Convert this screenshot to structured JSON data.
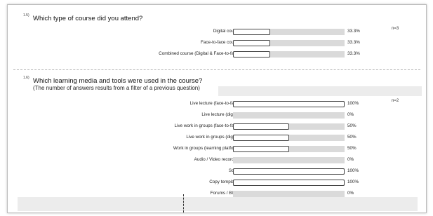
{
  "q1": {
    "number": "1.5)",
    "title": "Which type of course did you attend?",
    "n": "n=3",
    "rows": [
      {
        "label": "Digital course",
        "value": 33.3,
        "pct": "33.3%"
      },
      {
        "label": "Face-to-face course",
        "value": 33.3,
        "pct": "33.3%"
      },
      {
        "label": "Combined course (Digital & Face-to-face)",
        "value": 33.3,
        "pct": "33.3%"
      }
    ]
  },
  "q2": {
    "number": "1.6)",
    "title": "Which learning media and tools were used in the course?",
    "subtitle": "(The number of answers results from a filter of a previous question)",
    "n": "n=2",
    "rows": [
      {
        "label": "Live lecture (face-to-face)",
        "value": 100,
        "pct": "100%"
      },
      {
        "label": "Live lecture (digital)",
        "value": 0,
        "pct": "0%"
      },
      {
        "label": "Live work in groups (face-to-face)",
        "value": 50,
        "pct": "50%"
      },
      {
        "label": "Live work in groups (digital)",
        "value": 50,
        "pct": "50%"
      },
      {
        "label": "Work in groups (learning platform)",
        "value": 50,
        "pct": "50%"
      },
      {
        "label": "Audio / Video recording",
        "value": 0,
        "pct": "0%"
      },
      {
        "label": "Script",
        "value": 100,
        "pct": "100%"
      },
      {
        "label": "Copy templates",
        "value": 100,
        "pct": "100%"
      },
      {
        "label": "Forums / Blogs",
        "value": 0,
        "pct": "0%"
      }
    ]
  }
}
